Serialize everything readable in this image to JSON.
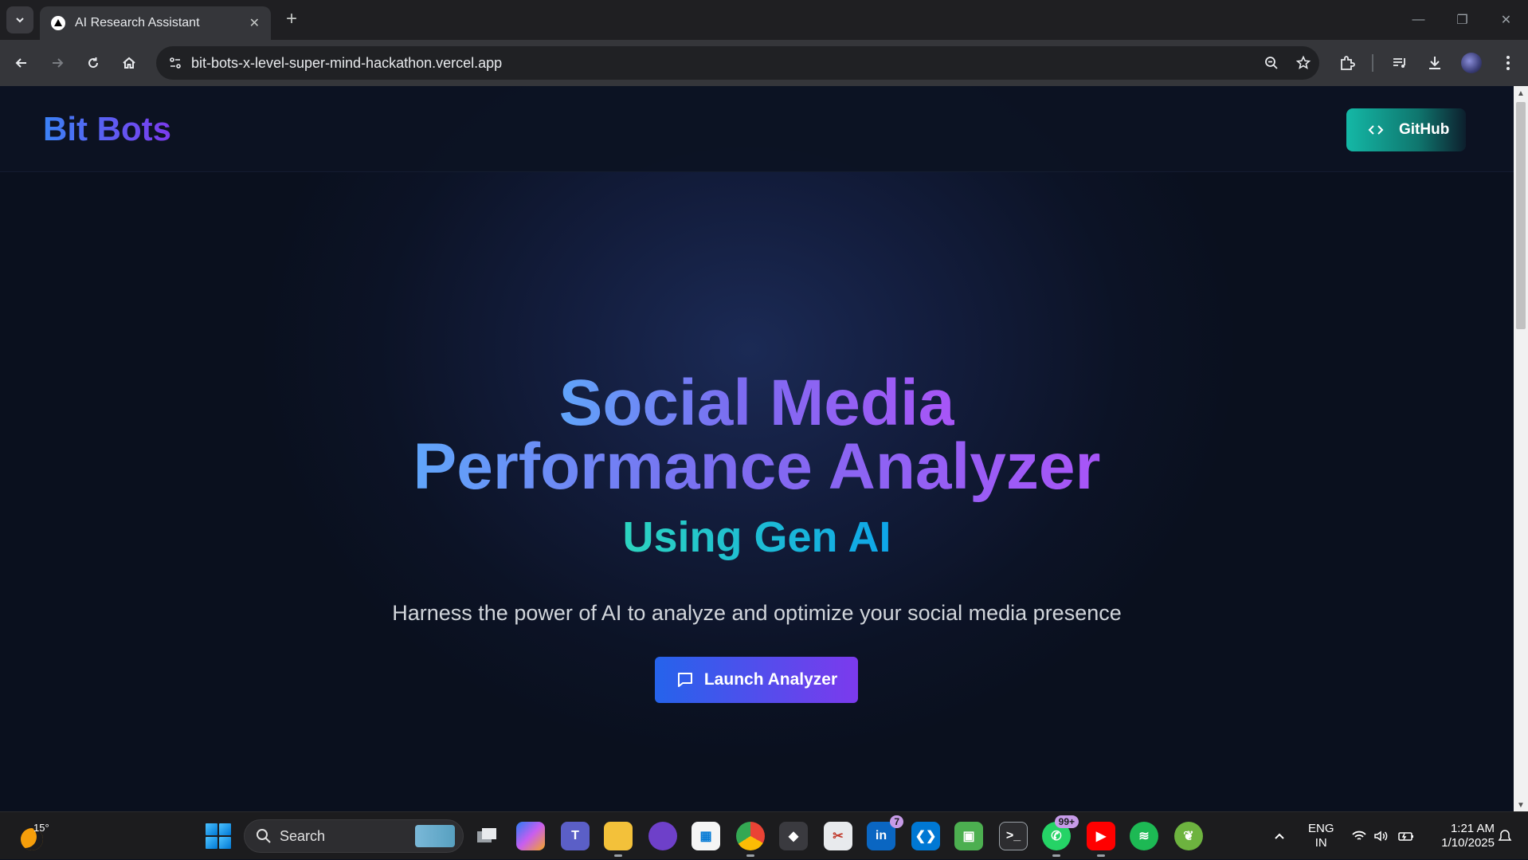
{
  "browser": {
    "tab_title": "AI Research Assistant",
    "url": "bit-bots-x-level-super-mind-hackathon.vercel.app"
  },
  "page": {
    "brand": "Bit Bots",
    "github_label": "GitHub",
    "headline_line1": "Social Media",
    "headline_line2": "Performance Analyzer",
    "subheadline": "Using Gen AI",
    "tagline": "Harness the power of AI to analyze and optimize your social media presence",
    "cta_label": "Launch Analyzer"
  },
  "taskbar": {
    "temperature": "15°",
    "search_label": "Search",
    "linkedin_badge": "7",
    "whatsapp_badge": "99+",
    "lang_line1": "ENG",
    "lang_line2": "IN",
    "time": "1:21 AM",
    "date": "1/10/2025"
  },
  "colors": {
    "accent_blue": "#2563eb",
    "accent_purple": "#7c3aed",
    "accent_teal": "#14b8a6",
    "page_bg": "#0b1222"
  }
}
